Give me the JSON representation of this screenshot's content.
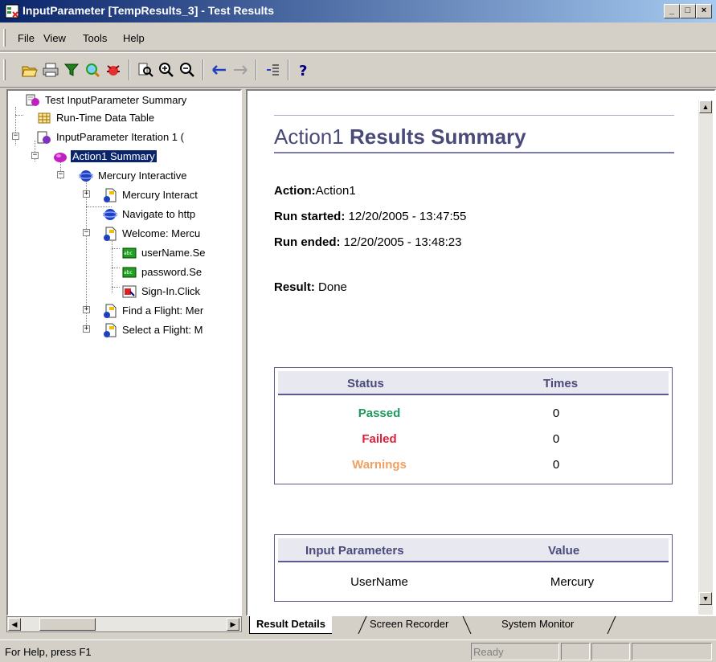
{
  "window": {
    "title": "InputParameter [TempResults_3] - Test Results",
    "controls": {
      "minimize": "_",
      "maximize": "□",
      "close": "×"
    }
  },
  "menu": {
    "items": [
      {
        "label": "File"
      },
      {
        "label": "View"
      },
      {
        "label": "Tools"
      },
      {
        "label": "Help"
      }
    ]
  },
  "toolbar": {
    "icons": [
      "open-folder-icon",
      "print-icon",
      "filter-icon",
      "find-icon",
      "bug-report-icon",
      "find-text-icon",
      "zoom-in-icon",
      "zoom-out-icon",
      "back-arrow-icon",
      "forward-arrow-icon",
      "expand-tree-icon",
      "help-icon"
    ]
  },
  "tree": {
    "items": [
      {
        "label": "Test InputParameter Summary"
      },
      {
        "label": "Run-Time Data Table"
      },
      {
        "label": "InputParameter Iteration 1 ("
      },
      {
        "label": "Action1 Summary"
      },
      {
        "label": "Mercury Interactive"
      },
      {
        "label": "Mercury Interact"
      },
      {
        "label": "Navigate to http"
      },
      {
        "label": "Welcome: Mercu"
      },
      {
        "label": "userName.Se"
      },
      {
        "label": "password.Se"
      },
      {
        "label": "Sign-In.Click"
      },
      {
        "label": "Find a Flight: Mer"
      },
      {
        "label": "Select a Flight: M"
      }
    ]
  },
  "results": {
    "title_prefix": "Action1",
    "title_suffix": "Results Summary",
    "action_label": "Action:",
    "action_value": "Action1",
    "run_started_label": "Run started:",
    "run_started_value": "12/20/2005 - 13:47:55",
    "run_ended_label": "Run ended:",
    "run_ended_value": "12/20/2005 - 13:48:23",
    "result_label": "Result:",
    "result_value": "Done",
    "status_table": {
      "headers": [
        "Status",
        "Times"
      ],
      "rows": [
        {
          "status": "Passed",
          "times": "0",
          "color": "#1a9a5a"
        },
        {
          "status": "Failed",
          "times": "0",
          "color": "#e0203a"
        },
        {
          "status": "Warnings",
          "times": "0",
          "color": "#f0a060"
        }
      ]
    },
    "params_table": {
      "headers": [
        "Input Parameters",
        "Value"
      ],
      "rows": [
        {
          "name": "UserName",
          "value": "Mercury"
        }
      ]
    }
  },
  "tabs": [
    {
      "label": "Result Details",
      "active": true
    },
    {
      "label": "Screen Recorder",
      "active": false
    },
    {
      "label": "System Monitor",
      "active": false
    }
  ],
  "statusbar": {
    "help_text": "For Help, press F1",
    "state": "Ready"
  }
}
